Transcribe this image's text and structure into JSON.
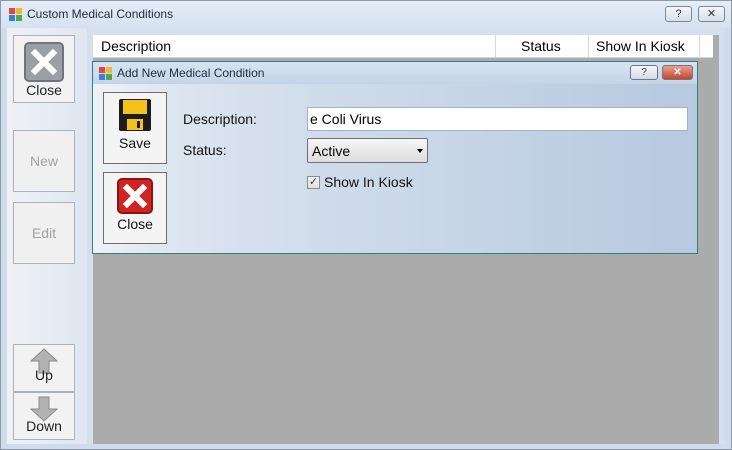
{
  "window": {
    "title": "Custom Medical Conditions",
    "help_glyph": "?",
    "close_glyph": "✕"
  },
  "sidebar": {
    "close_label": "Close",
    "new_label": "New",
    "edit_label": "Edit",
    "up_label": "Up",
    "down_label": "Down"
  },
  "grid": {
    "columns": [
      "Description",
      "Status",
      "Show In Kiosk"
    ]
  },
  "dialog": {
    "title": "Add New Medical Condition",
    "help_glyph": "?",
    "close_glyph": "✕",
    "save_label": "Save",
    "close_label": "Close",
    "description_label": "Description:",
    "description_value": "e Coli Virus",
    "status_label": "Status:",
    "status_value": "Active",
    "show_in_kiosk_label": "Show In Kiosk",
    "show_in_kiosk_checked": true,
    "check_glyph": "✓"
  },
  "colors": {
    "close_red": "#d02424",
    "save_yellow": "#f4c21a",
    "disabled_text": "#a3a3a3"
  }
}
